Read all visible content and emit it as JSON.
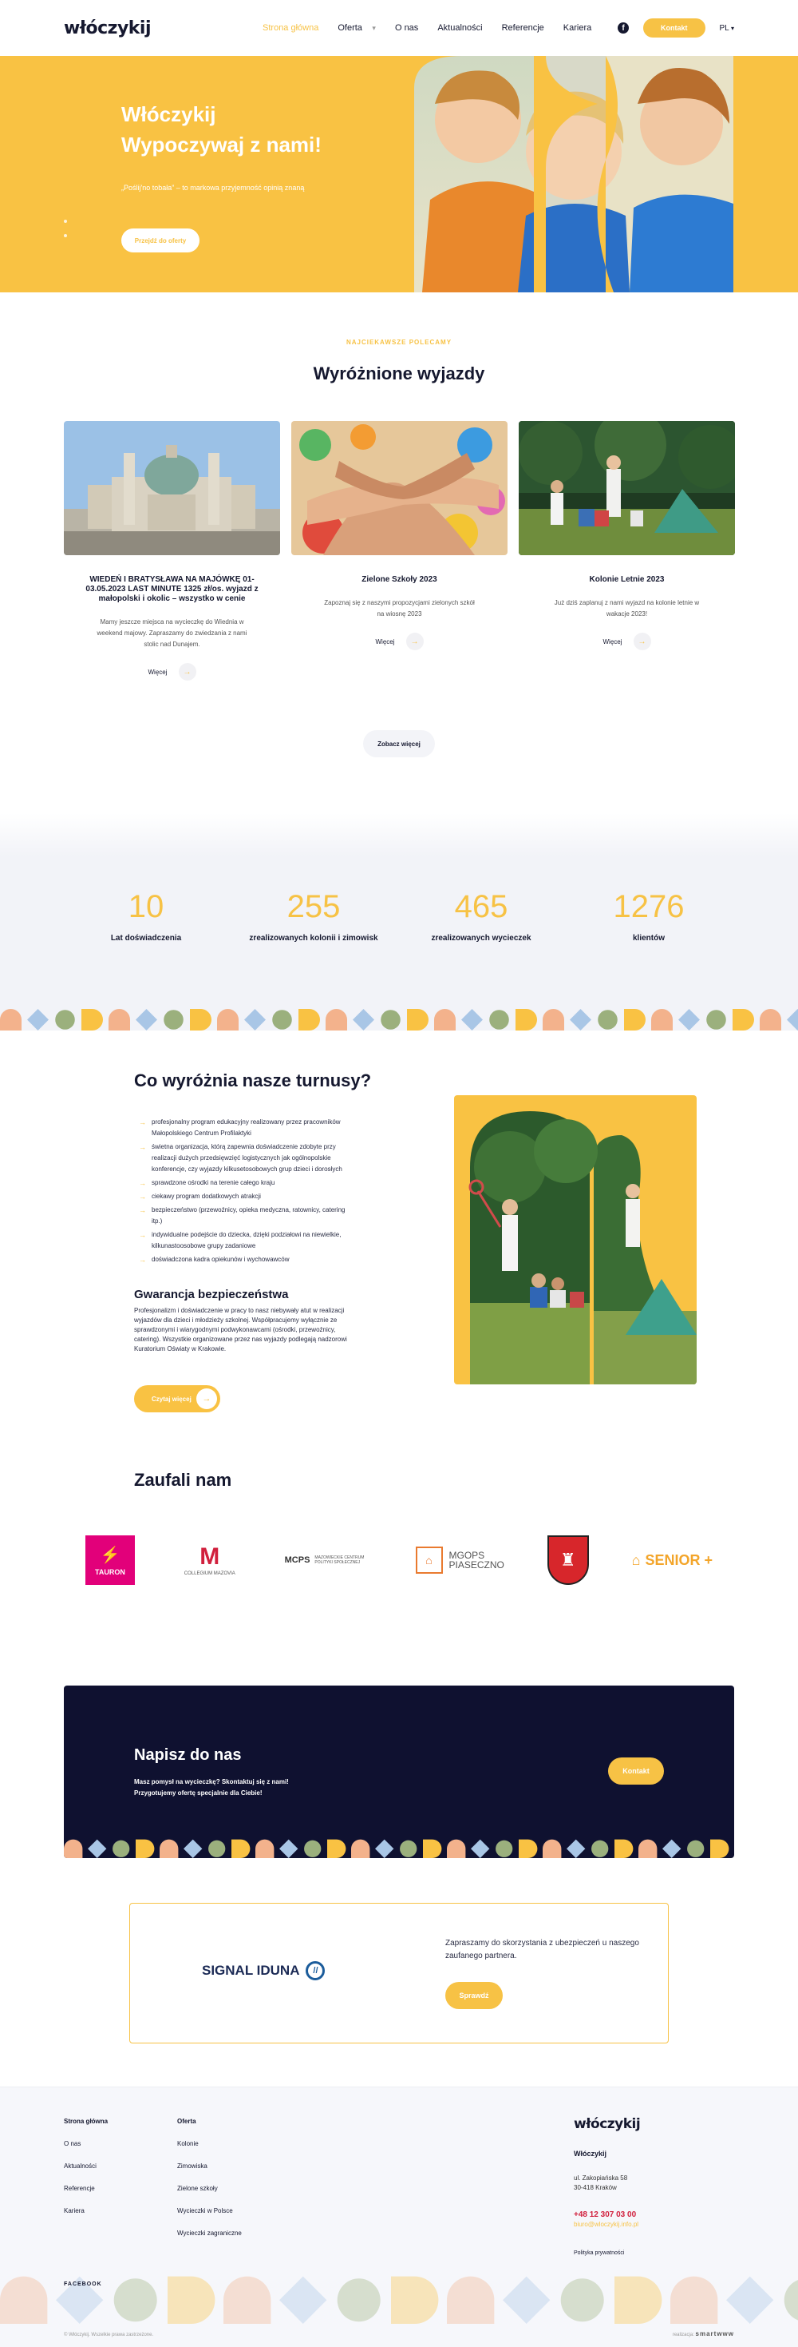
{
  "nav": {
    "logo": "włóczykij",
    "items": [
      {
        "label": "Strona główna",
        "active": true
      },
      {
        "label": "Oferta",
        "dropdown": true
      },
      {
        "label": "O nas"
      },
      {
        "label": "Aktualności"
      },
      {
        "label": "Referencje"
      },
      {
        "label": "Kariera"
      }
    ],
    "social_icon": "facebook-icon",
    "contact_button": "Kontakt",
    "language": "PL"
  },
  "hero": {
    "title_line1": "Włóczykij",
    "title_line2": "Wypoczywaj z nami!",
    "subtitle": "„Poślij'no tobała” – to markowa przyjemność opinią znaną",
    "button": "Przejdź do oferty"
  },
  "featured": {
    "eyebrow": "NAJCIEKAWSZE POLECAMY",
    "title": "Wyróżnione wyjazdy",
    "cards": [
      {
        "title": "WIEDEŃ I BRATYSŁAWA NA MAJÓWKĘ 01-03.05.2023 LAST MINUTE 1325 zł/os. wyjazd z małopolski i okolic – wszystko w cenie",
        "description": "Mamy jeszcze miejsca na wycieczkę do Wiednia w weekend majowy. Zapraszamy do zwiedzania z nami stolic nad Dunajem.",
        "more": "Więcej"
      },
      {
        "title": "Zielone Szkoły 2023",
        "description": "Zapoznaj się z naszymi propozycjami zielonych szkół na wiosnę 2023",
        "more": "Więcej"
      },
      {
        "title": "Kolonie Letnie 2023",
        "description": "Już dziś zaplanuj z nami wyjazd na kolonie letnie w wakacje 2023!",
        "more": "Więcej"
      }
    ],
    "see_more": "Zobacz więcej"
  },
  "stats": [
    {
      "value": "10",
      "label": "Lat doświadczenia"
    },
    {
      "value": "255",
      "label": "zrealizowanych kolonii i zimowisk"
    },
    {
      "value": "465",
      "label": "zrealizowanych wycieczek"
    },
    {
      "value": "1276",
      "label": "klientów"
    }
  ],
  "turnusy": {
    "title": "Co wyróżnia nasze turnusy?",
    "features": [
      "profesjonalny program edukacyjny realizowany przez pracowników Małopolskiego Centrum Profilaktyki",
      "świetna organizacja, którą zapewnia doświadczenie zdobyte przy realizacji dużych przedsięwzięć logistycznych jak ogólnopolskie konferencje, czy wyjazdy kilkusetosobowych grup dzieci i dorosłych",
      "sprawdzone ośrodki na terenie całego kraju",
      "ciekawy program dodatkowych atrakcji",
      "bezpieczeństwo (przewoźnicy, opieka medyczna, ratownicy, catering itp.)",
      "indywidualne podejście do dziecka, dzięki podziałowi na niewielkie, kilkunastoosobowe grupy zadaniowe",
      "doświadczona kadra opiekunów i wychowawców"
    ],
    "guarantee_title": "Gwarancja bezpieczeństwa",
    "guarantee_text": "Profesjonalizm i doświadczenie w pracy to nasz niebywały atut w realizacji wyjazdów dla dzieci i młodzieży szkolnej. Współpracujemy wyłącznie ze sprawdzonymi i wiarygodnymi podwykonawcami (ośrodki, przewoźnicy, catering). Wszystkie organizowane przez nas wyjazdy podlegają nadzorowi Kuratorium Oświaty w Krakowie.",
    "read_more": "Czytaj więcej"
  },
  "trusted": {
    "title": "Zaufali nam",
    "logos": {
      "tauron": "TAURON",
      "mazovia": "COLLEGIUM MAZOVIA",
      "mcps_short": "MCPS",
      "mcps_long": "MAZOWIECKIE CENTRUM POLITYKI SPOŁECZNEJ",
      "mgops_line1": "MGOPS",
      "mgops_line2": "PIASECZNO",
      "senior": "SENIOR +"
    }
  },
  "contact": {
    "title": "Napisz do nas",
    "text": "Masz pomysł na wycieczkę? Skontaktuj się z nami! Przygotujemy ofertę specjalnie dla Ciebie!",
    "button": "Kontakt"
  },
  "insurance": {
    "brand": "SIGNAL IDUNA",
    "text": "Zapraszamy do skorzystania z ubezpieczeń u naszego zaufanego partnera.",
    "button": "Sprawdź"
  },
  "footer": {
    "col1": [
      "Strona główna",
      "O nas",
      "Aktualności",
      "Referencje",
      "Kariera"
    ],
    "col2": [
      "Oferta",
      "Kolonie",
      "Zimowiska",
      "Zielone szkoły",
      "Wycieczki w Polsce",
      "Wycieczki zagraniczne"
    ],
    "logo": "włóczykij",
    "company": "Włóczykij",
    "address_line1": "ul. Zakopiańska 58",
    "address_line2": "30-418 Kraków",
    "phone": "+48 12 307 03 00",
    "email": "biuro@wloczykij.info.pl",
    "policy": "Polityka prywatności",
    "facebook": "FACEBOOK",
    "copyright": "© Włóczykij. Wszelkie prawa zastrzeżone.",
    "made_by_label": "realizacja:",
    "made_by": "smartwww"
  },
  "colors": {
    "accent": "#f9c243",
    "dark": "#0f1130",
    "footer_bg": "#f6f7fb"
  }
}
